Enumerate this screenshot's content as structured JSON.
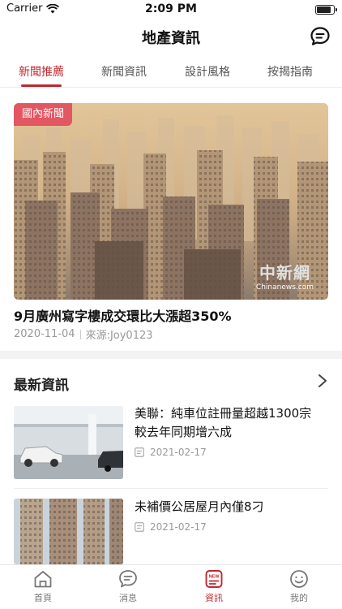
{
  "status_bar": {
    "carrier": "Carrier",
    "time": "2:09 PM",
    "battery_level": 0.9
  },
  "header": {
    "title": "地產資訊",
    "chat_icon": "chat-bubble-icon"
  },
  "tabs": [
    {
      "label": "新聞推薦",
      "active": true
    },
    {
      "label": "新聞資訊",
      "active": false
    },
    {
      "label": "設計風格",
      "active": false
    },
    {
      "label": "按揭指南",
      "active": false
    }
  ],
  "featured": {
    "badge": "國內新聞",
    "title": "9月廣州寫字樓成交環比大漲超350%",
    "date": "2020-11-04",
    "source": "來源:Joy0123",
    "watermark_logo": "中新網",
    "watermark_sub": "Chinanews.com"
  },
  "latest": {
    "title": "最新資訊",
    "items": [
      {
        "title": "美聯：純車位註冊量超越1300宗　較去年同期增六成",
        "date": "2021-02-17"
      },
      {
        "title": "未補價公居屋月內僅8刁",
        "date": "2021-02-17"
      }
    ]
  },
  "tab_bar": [
    {
      "label": "首頁",
      "icon": "home-icon",
      "active": false
    },
    {
      "label": "消息",
      "icon": "message-icon",
      "active": false
    },
    {
      "label": "資訊",
      "icon": "news-icon",
      "active": true
    },
    {
      "label": "我的",
      "icon": "profile-icon",
      "active": false
    }
  ],
  "colors": {
    "accent": "#c1272d",
    "badge": "#e35763",
    "divider": "#f3f3f3"
  }
}
